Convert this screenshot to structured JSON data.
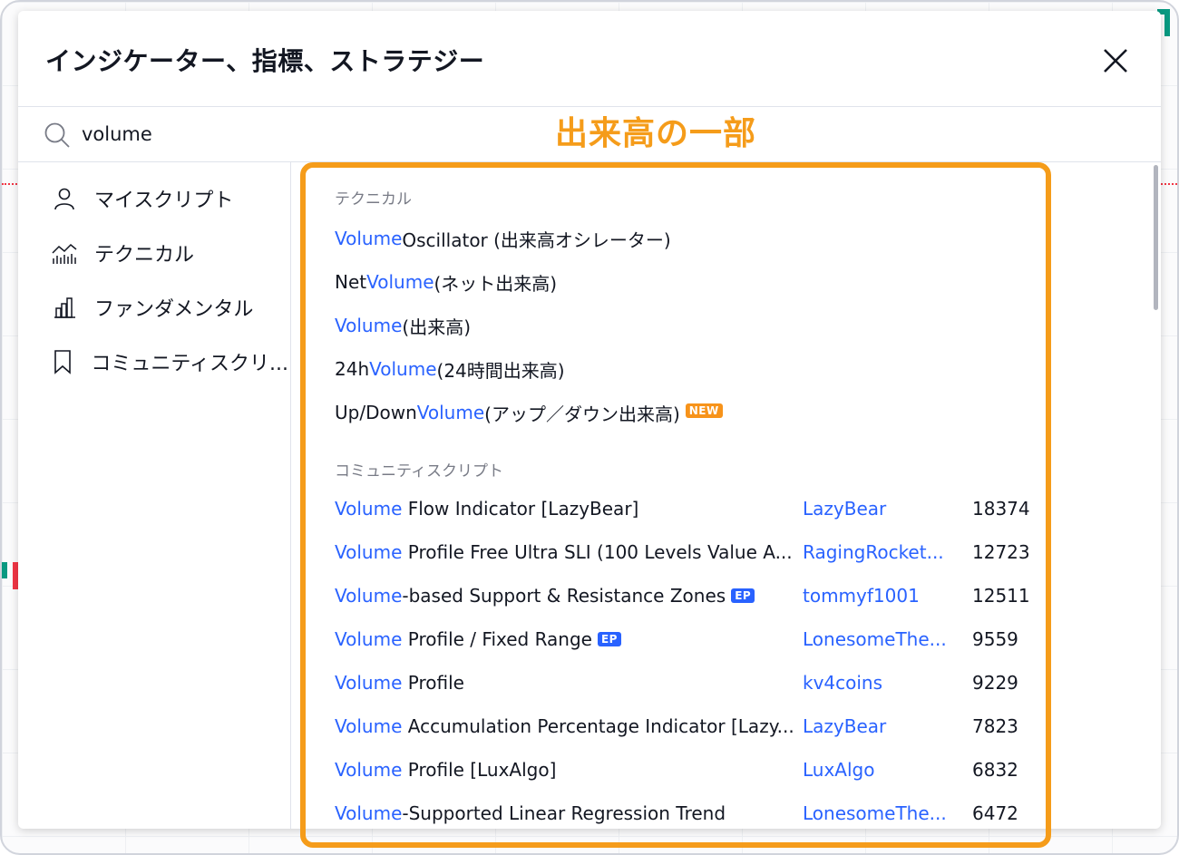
{
  "dialog": {
    "title": "インジケーター、指標、ストラテジー",
    "close_icon": "close-icon"
  },
  "search": {
    "value": "volume",
    "placeholder": "",
    "icon": "search-icon"
  },
  "sidebar": {
    "items": [
      {
        "label": "マイスクリプト",
        "icon": "user-icon"
      },
      {
        "label": "テクニカル",
        "icon": "chart-icon"
      },
      {
        "label": "ファンダメンタル",
        "icon": "bar-chart-icon"
      },
      {
        "label": "コミュニティスクリ...",
        "icon": "bookmark-icon"
      }
    ]
  },
  "technical": {
    "heading": "テクニカル",
    "items": [
      {
        "pre": "",
        "hl": "Volume",
        "post": " Oscillator (出来高オシレーター)",
        "badge": ""
      },
      {
        "pre": "Net ",
        "hl": "Volume",
        "post": " (ネット出来高)",
        "badge": ""
      },
      {
        "pre": "",
        "hl": "Volume",
        "post": " (出来高)",
        "badge": ""
      },
      {
        "pre": "24h ",
        "hl": "Volume",
        "post": " (24時間出来高)",
        "badge": ""
      },
      {
        "pre": "Up/Down ",
        "hl": "Volume",
        "post": " (アップ／ダウン出来高)",
        "badge": "NEW"
      }
    ]
  },
  "community": {
    "heading": "コミュニティスクリプト",
    "items": [
      {
        "hl": "Volume",
        "post": " Flow Indicator [LazyBear]",
        "badge": "",
        "author": "LazyBear",
        "count": "18374"
      },
      {
        "hl": "Volume",
        "post": " Profile Free Ultra SLI (100 Levels Value A...",
        "badge": "",
        "author": "RagingRocket...",
        "count": "12723"
      },
      {
        "hl": "Volume",
        "post": "-based Support & Resistance Zones",
        "badge": "EP",
        "author": "tommyf1001",
        "count": "12511"
      },
      {
        "hl": "Volume",
        "post": " Profile / Fixed Range",
        "badge": "EP",
        "author": "LonesomeThe...",
        "count": "9559"
      },
      {
        "hl": "Volume",
        "post": " Profile",
        "badge": "",
        "author": "kv4coins",
        "count": "9229"
      },
      {
        "hl": "Volume",
        "post": " Accumulation Percentage Indicator [Lazy...",
        "badge": "",
        "author": "LazyBear",
        "count": "7823"
      },
      {
        "hl": "Volume",
        "post": " Profile [LuxAlgo]",
        "badge": "",
        "author": "LuxAlgo",
        "count": "6832"
      },
      {
        "hl": "Volume",
        "post": "-Supported Linear Regression Trend",
        "badge": "",
        "author": "LonesomeThe...",
        "count": "6472"
      }
    ]
  },
  "annotation": {
    "label": "出来高の一部",
    "color": "#f59c1a"
  },
  "colors": {
    "highlight": "#2962ff",
    "new_badge": "#f7931a",
    "ep_badge": "#2962ff"
  }
}
